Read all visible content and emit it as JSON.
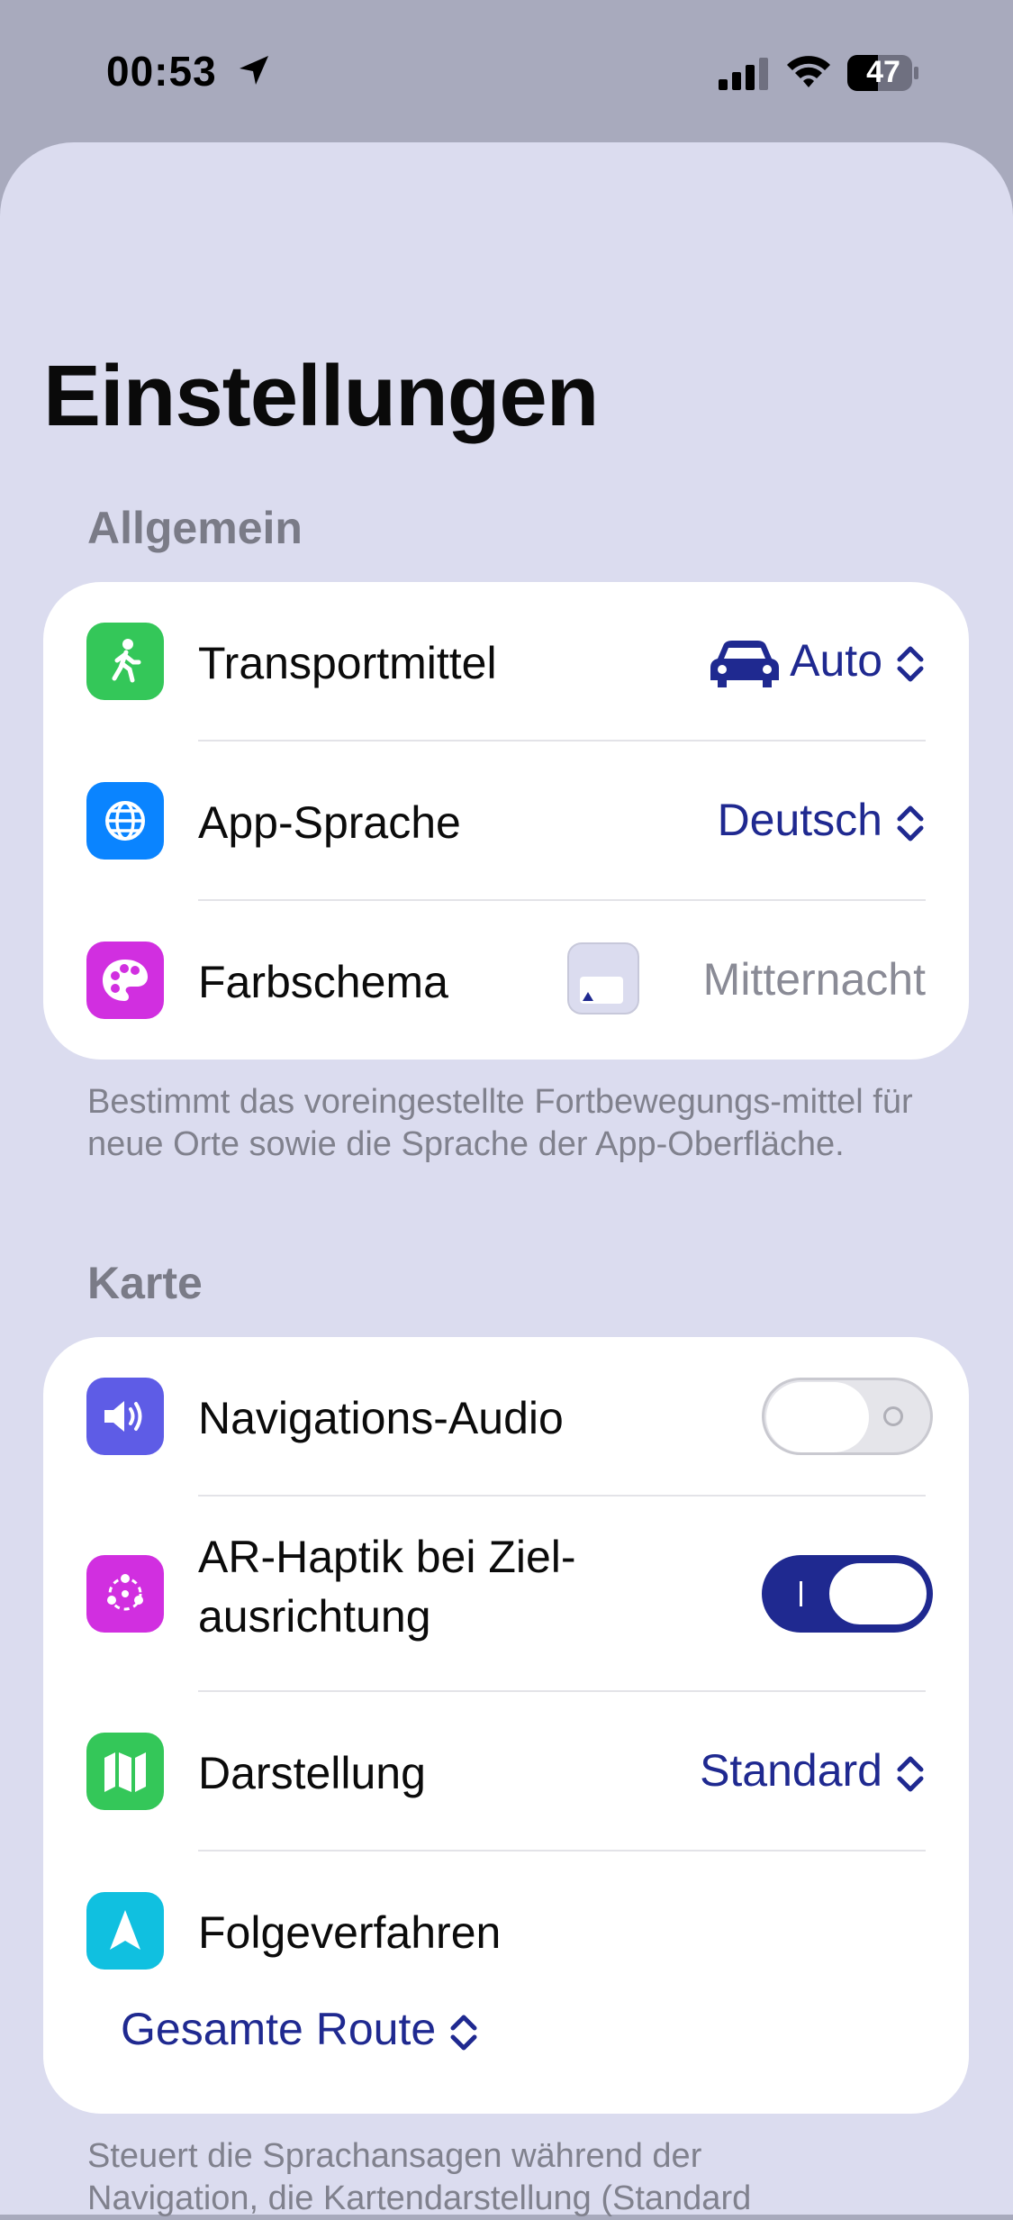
{
  "status": {
    "time": "00:53",
    "battery": "47",
    "icons": [
      "location-arrow-icon",
      "cellular-signal-icon",
      "wifi-icon",
      "battery-icon"
    ]
  },
  "title": "Einstellungen",
  "colors": {
    "accent": "#1f2990",
    "toggle_on": "#1f2990",
    "toggle_off": "#e5e5ea",
    "green": "#34c759",
    "blue": "#0a84ff",
    "magenta": "#d12fe0",
    "indigo": "#5e5ce6",
    "cyan": "#10c0e0"
  },
  "general": {
    "header": "Allgemein",
    "rows": [
      {
        "label": "Transportmittel",
        "value": "Auto",
        "icon": "walking-person-icon",
        "value_icon": "car-icon"
      },
      {
        "label": "App-Sprache",
        "value": "Deutsch",
        "icon": "globe-icon"
      },
      {
        "label": "Farbschema",
        "value": "Mitternacht",
        "icon": "palette-icon"
      }
    ],
    "footer": "Bestimmt das voreingestellte Fortbewegungs-mittel für neue Orte sowie die Sprache der App-Oberfläche."
  },
  "map": {
    "header": "Karte",
    "rows": [
      {
        "label": "Navigations-Audio",
        "icon": "speaker-icon",
        "toggle": false
      },
      {
        "label_line1": "AR-Haptik bei Ziel-",
        "label_line2": "ausrichtung",
        "icon": "haptics-icon",
        "toggle": true
      },
      {
        "label": "Darstellung",
        "value": "Standard",
        "icon": "map-icon"
      },
      {
        "label": "Folgeverfahren",
        "value": "Gesamte Route",
        "icon": "navigation-arrow-icon"
      }
    ],
    "footer_line1": "Steuert die Sprachansagen während der",
    "footer_line2": "Navigation, die Kartendarstellung (Standard"
  }
}
